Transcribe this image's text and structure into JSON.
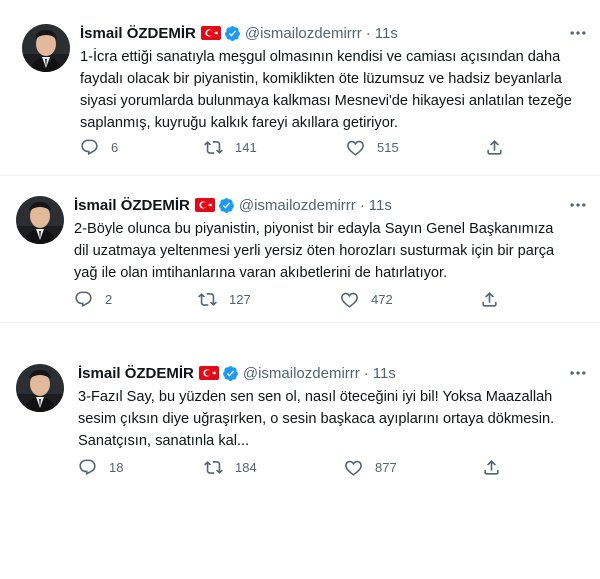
{
  "tweets": [
    {
      "author": "İsmail ÖZDEMİR",
      "handle": "@ismailozdemirrr",
      "separator": "·",
      "time": "11s",
      "text": "1-İcra ettiği sanatıyla meşgul olmasının kendisi ve camiası açısından daha\nfaydalı olacak bir piyanistin, komiklikten öte lüzumsuz ve hadsiz beyanlarla\nsiyasi yorumlarda bulunmaya kalkması Mesnevi'de hikayesi anlatılan tezeğe\nsaplanmış, kuyruğu kalkık fareyi akıllara getiriyor.",
      "replies": "6",
      "retweets": "141",
      "likes": "515"
    },
    {
      "author": "İsmail ÖZDEMİR",
      "handle": "@ismailozdemirrr",
      "separator": "·",
      "time": "11s",
      "text": "2-Böyle olunca bu piyanistin, piyonist bir edayla Sayın Genel Başkanımıza\ndil uzatmaya yeltenmesi yerli yersiz öten horozları susturmak için bir parça\nyağ ile olan imtihanlarına varan akıbetlerini de hatırlatıyor.",
      "replies": "2",
      "retweets": "127",
      "likes": "472"
    },
    {
      "author": "İsmail ÖZDEMİR",
      "handle": "@ismailozdemirrr",
      "separator": "·",
      "time": "11s",
      "text": "3-Fazıl Say, bu yüzden sen sen ol, nasıl öteceğini iyi bil! Yoksa Maazallah\nsesim çıksın diye uğraşırken, o sesin başkaca ayıplarını ortaya dökmesin.\nSanatçısın, sanatınla kal...",
      "replies": "18",
      "retweets": "184",
      "likes": "877"
    }
  ],
  "colors": {
    "text": "#0f1419",
    "muted": "#536471",
    "verified": "#1d9bf0",
    "flag": "#e30a17",
    "divider": "#eff3f4"
  },
  "icons": [
    "avatar",
    "turkey-flag-icon",
    "verified-badge-icon",
    "more-icon",
    "reply-icon",
    "retweet-icon",
    "like-icon",
    "share-icon"
  ]
}
